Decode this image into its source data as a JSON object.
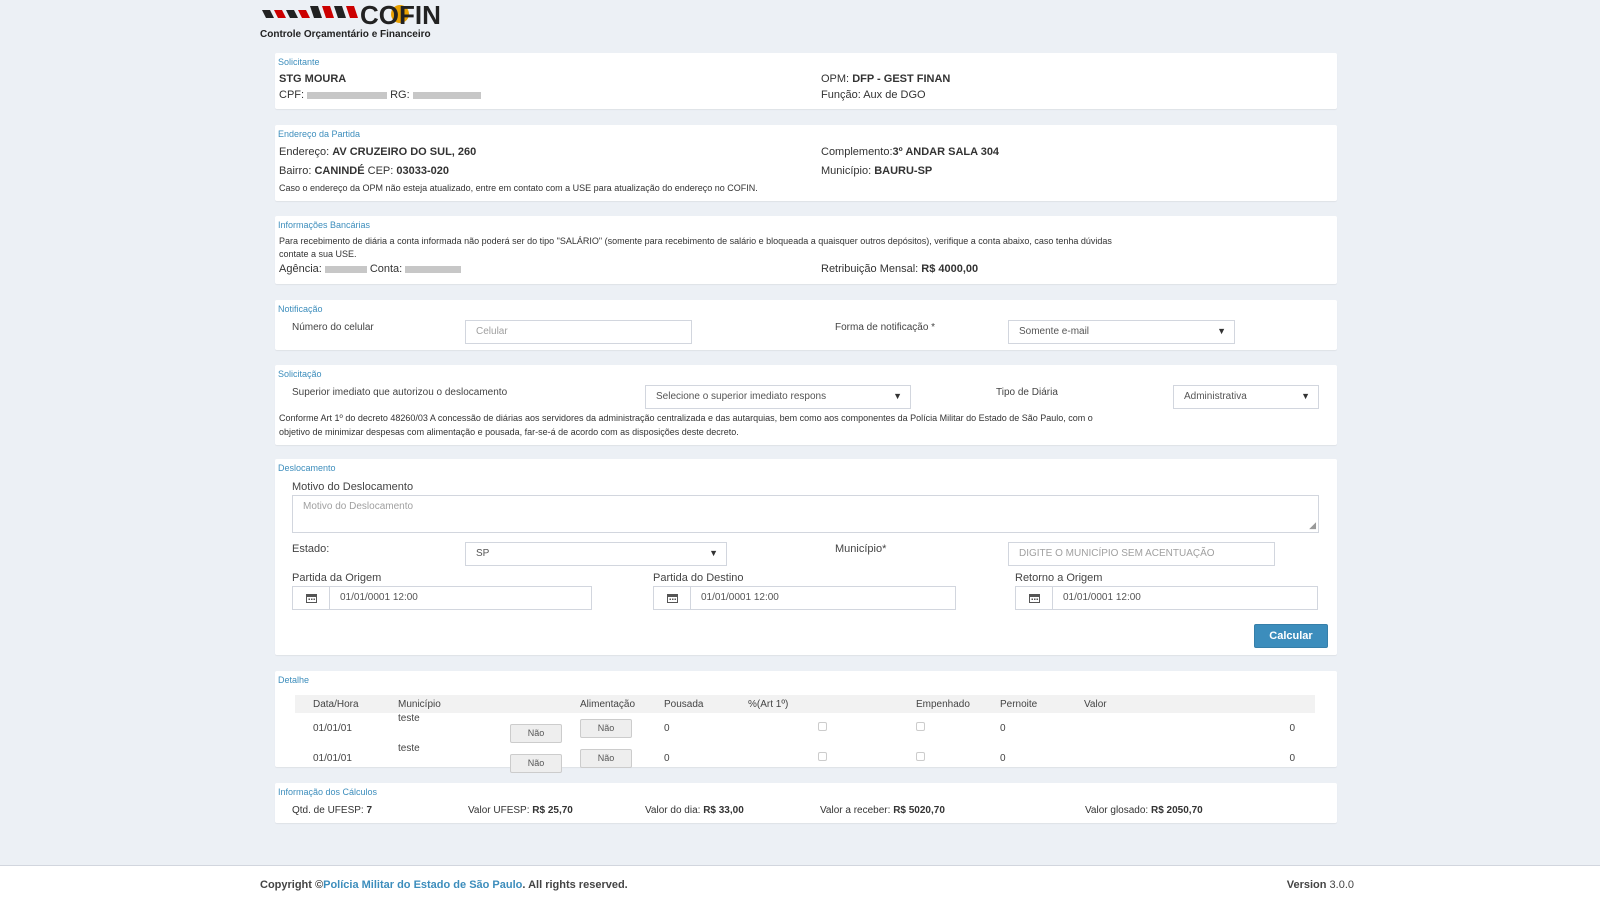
{
  "brand": {
    "name": "COFIN",
    "subtitle": "Controle Orçamentário e Financeiro"
  },
  "solicitante": {
    "title": "Solicitante",
    "name": "STG MOURA",
    "cpf_label": "CPF:",
    "rg_label": "RG:",
    "opm_label": "OPM:",
    "opm_value": "DFP - GEST FINAN",
    "funcao_label": "Função:",
    "funcao_value": "Aux de DGO"
  },
  "endereco": {
    "title": "Endereço da Partida",
    "endereco_label": "Endereço:",
    "endereco_value": "AV CRUZEIRO DO SUL, 260",
    "complemento_label": "Complemento:",
    "complemento_value": "3º ANDAR SALA 304",
    "bairro_label": "Bairro:",
    "bairro_value": "CANINDÉ",
    "cep_label": "CEP:",
    "cep_value": "03033-020",
    "municipio_label": "Município:",
    "municipio_value": "BAURU-SP",
    "note": "Caso o endereço da OPM não esteja atualizado, entre em contato com a USE para atualização do endereço no COFIN."
  },
  "bancarias": {
    "title": "Informações Bancárias",
    "note": "Para recebimento de diária a conta informada não poderá ser do tipo \"SALÁRIO\" (somente para recebimento de salário e bloqueada a quaisquer outros depósitos), verifique a conta abaixo, caso tenha dúvidas",
    "note2": "contate a sua USE.",
    "agencia_label": "Agência:",
    "conta_label": "Conta:",
    "retribuicao_label": "Retribuição Mensal:",
    "retribuicao_value": "R$ 4000,00"
  },
  "notificacao": {
    "title": "Notificação",
    "celular_label": "Número do celular",
    "celular_placeholder": "Celular",
    "forma_label": "Forma de notificação *",
    "forma_value": "Somente e-mail"
  },
  "solicitacao": {
    "title": "Solicitação",
    "superior_label": "Superior imediato que autorizou o deslocamento",
    "superior_value": "Selecione o superior imediato respons",
    "tipo_label": "Tipo de Diária",
    "tipo_value": "Administrativa",
    "note": "Conforme Art 1º do decreto 48260/03 A concessão de diárias aos servidores da administração centralizada e das autarquias, bem como aos componentes da Polícia Militar do Estado de São Paulo, com o",
    "note2": "objetivo de minimizar despesas com alimentação e pousada, far-se-á de acordo com as disposições deste decreto."
  },
  "deslocamento": {
    "title": "Deslocamento",
    "motivo_label": "Motivo do Deslocamento",
    "motivo_placeholder": "Motivo do Deslocamento",
    "estado_label": "Estado:",
    "estado_value": "SP",
    "municipio_label": "Município*",
    "municipio_placeholder": "DIGITE O MUNICÍPIO SEM ACENTUAÇÃO",
    "partida_origem_label": "Partida da Origem",
    "partida_origem_value": "01/01/0001 12:00",
    "partida_destino_label": "Partida do Destino",
    "partida_destino_value": "01/01/0001 12:00",
    "retorno_origem_label": "Retorno a Origem",
    "retorno_origem_value": "01/01/0001 12:00",
    "calcular_label": "Calcular"
  },
  "detalhe": {
    "title": "Detalhe",
    "columns": [
      "Data/Hora",
      "Município",
      "Alimentação",
      "Pousada",
      "%(Art 1º)",
      "Empenhado",
      "Pernoite",
      "Valor"
    ],
    "rows": [
      {
        "data": "01/01/01",
        "municipio": "teste",
        "btn1": "Não",
        "btn2": "Não",
        "pousada": "0",
        "pernoite": "0",
        "valor": "0"
      },
      {
        "data": "01/01/01",
        "municipio": "teste",
        "btn1": "Não",
        "btn2": "Não",
        "pousada": "0",
        "pernoite": "0",
        "valor": "0"
      }
    ]
  },
  "calculos": {
    "title": "Informação dos Cálculos",
    "qtd_label": "Qtd. de UFESP:",
    "qtd_value": "7",
    "valor_ufesp_label": "Valor UFESP:",
    "valor_ufesp_value": "R$ 25,70",
    "valor_dia_label": "Valor do dia:",
    "valor_dia_value": "R$ 33,00",
    "valor_receber_label": "Valor a receber:",
    "valor_receber_value": "R$ 5020,70",
    "valor_glosado_label": "Valor glosado:",
    "valor_glosado_value": "R$ 2050,70"
  },
  "footer": {
    "copyright_prefix": "Copyright ©",
    "copyright_link": "Polícia Militar do Estado de São Paulo",
    "copyright_suffix": ". All rights reserved.",
    "version_label": "Version",
    "version_value": "3.0.0"
  }
}
